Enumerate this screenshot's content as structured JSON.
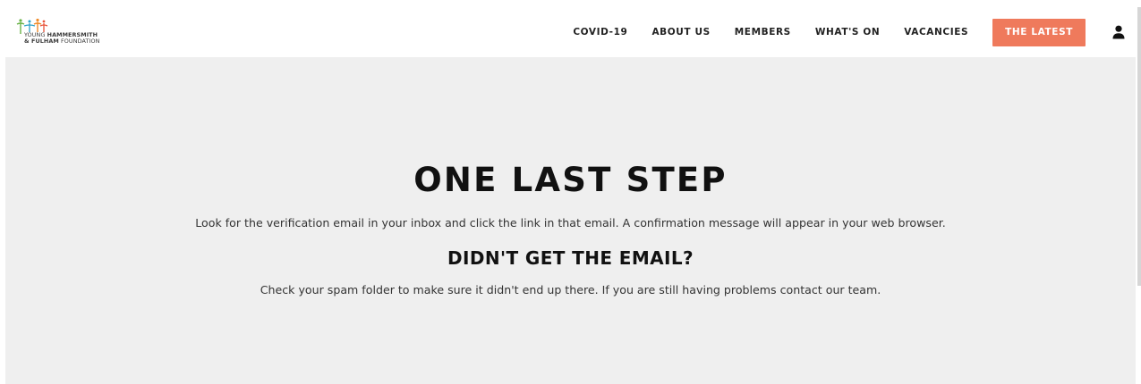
{
  "logo": {
    "line1_prefix": "YOUNG ",
    "line1_bold": "HAMMERSMITH",
    "line2_bold": "& FULHAM",
    "line2_suffix": " FOUNDATION",
    "colors": [
      "#6bb34a",
      "#f08b2a",
      "#2fa2c9",
      "#e8543b"
    ]
  },
  "nav": {
    "items": [
      {
        "label": "COVID-19"
      },
      {
        "label": "ABOUT US"
      },
      {
        "label": "MEMBERS"
      },
      {
        "label": "WHAT'S ON"
      },
      {
        "label": "VACANCIES"
      }
    ],
    "cta_label": "THE LATEST",
    "cta_color": "#ef7a5c",
    "account_icon": "user-icon"
  },
  "main": {
    "title": "ONE LAST STEP",
    "instructions": "Look for the verification email in your inbox and click the link in that email. A confirmation message will appear in your web browser.",
    "subheading": "DIDN'T GET THE EMAIL?",
    "help_text": "Check your spam folder to make sure it didn't end up there. If you are still having problems contact our team."
  }
}
